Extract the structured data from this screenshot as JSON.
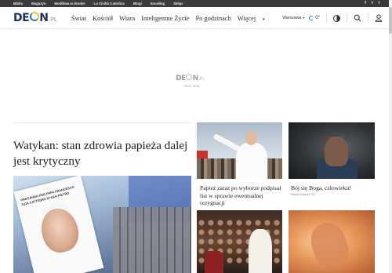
{
  "topbar": {
    "links": [
      "Biblia",
      "Magazyn",
      "Modlitwa w drodze",
      "La Civiltà Cattolica",
      "Blogi",
      "Escolbig",
      "Sklep"
    ],
    "social": [
      "f",
      "t",
      "i"
    ]
  },
  "nav": {
    "logo": {
      "de": "DE",
      "n": "N",
      "pl": ".PL"
    },
    "menu": [
      "Świat",
      "Kościół",
      "Wiara",
      "Inteligentne Życie",
      "Po godzinach",
      "Więcej"
    ],
    "more_caret": "▾",
    "city": "Warszawa",
    "city_caret": "▾",
    "temperature": "0°"
  },
  "ad": {
    "logo": {
      "de": "DE",
      "n": "N",
      "pl": ".PL"
    },
    "label": "REKLAMA"
  },
  "main_article": {
    "title": "Watykan: stan zdrowia papieża dalej jest krytyczny",
    "poster_text": "PREGANDO PER PAPA FRANCESCO EZIA CATTEDRA DI SAN PIETRO"
  },
  "cards": [
    {
      "title": "Papież zaraz po wyborze podpisał list w sprawie ewentualnej rezygnacji"
    },
    {
      "title": "Bój się Boga, człowieku!",
      "author": "Jakub Kwiatek SJ"
    }
  ],
  "colors": {
    "topbar": "#3b3b3d",
    "logo_navy": "#22305b",
    "logo_blue": "#2e73c8",
    "logo_yellow": "#f2c230"
  },
  "icons": [
    "weather-icon",
    "contrast-icon",
    "search-icon",
    "user-icon",
    "facebook-icon",
    "twitter-icon",
    "instagram-icon"
  ]
}
